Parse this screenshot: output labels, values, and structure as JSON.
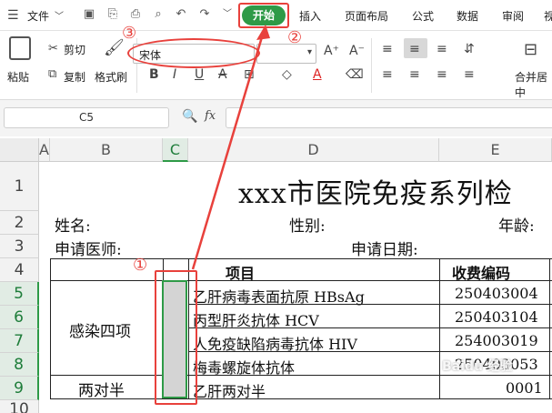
{
  "menu": {
    "file": "文件",
    "tabs": [
      "开始",
      "插入",
      "页面布局",
      "公式",
      "数据",
      "审阅",
      "视"
    ]
  },
  "ribbon": {
    "paste": "粘贴",
    "cut": "剪切",
    "copy": "复制",
    "format_painter": "格式刷",
    "font_name": "宋体",
    "merge_center": "合并居中"
  },
  "formula_bar": {
    "name_box": "C5",
    "fx": "fx"
  },
  "columns": [
    "A",
    "B",
    "C",
    "D",
    "E"
  ],
  "rows": [
    "1",
    "2",
    "3",
    "4",
    "5",
    "6",
    "7",
    "8",
    "9",
    "10"
  ],
  "sheet": {
    "title": "xxx市医院免疫系列检",
    "name_label": "姓名:",
    "gender_label": "性别:",
    "age_label": "年龄:",
    "doctor_label": "申请医师:",
    "date_label": "申请日期:",
    "header_item": "项目",
    "header_code": "收费编码",
    "group1": "感染四项",
    "group2": "两对半",
    "items": [
      {
        "name": "乙肝病毒表面抗原 HBsAg",
        "code": "250403004"
      },
      {
        "name": "丙型肝炎抗体 HCV",
        "code": "250403104"
      },
      {
        "name": "人免疫缺陷病毒抗体 HIV",
        "code": "254003019"
      },
      {
        "name": "梅毒螺旋体抗体",
        "code": "250403053"
      },
      {
        "name": "乙肝两对半",
        "code": "0001"
      }
    ]
  },
  "annotations": {
    "one": "①",
    "two": "②",
    "three": "③"
  },
  "watermark": "Baidu 经验",
  "colors": {
    "accent": "#2e9a47",
    "annotation": "#e8413c"
  }
}
